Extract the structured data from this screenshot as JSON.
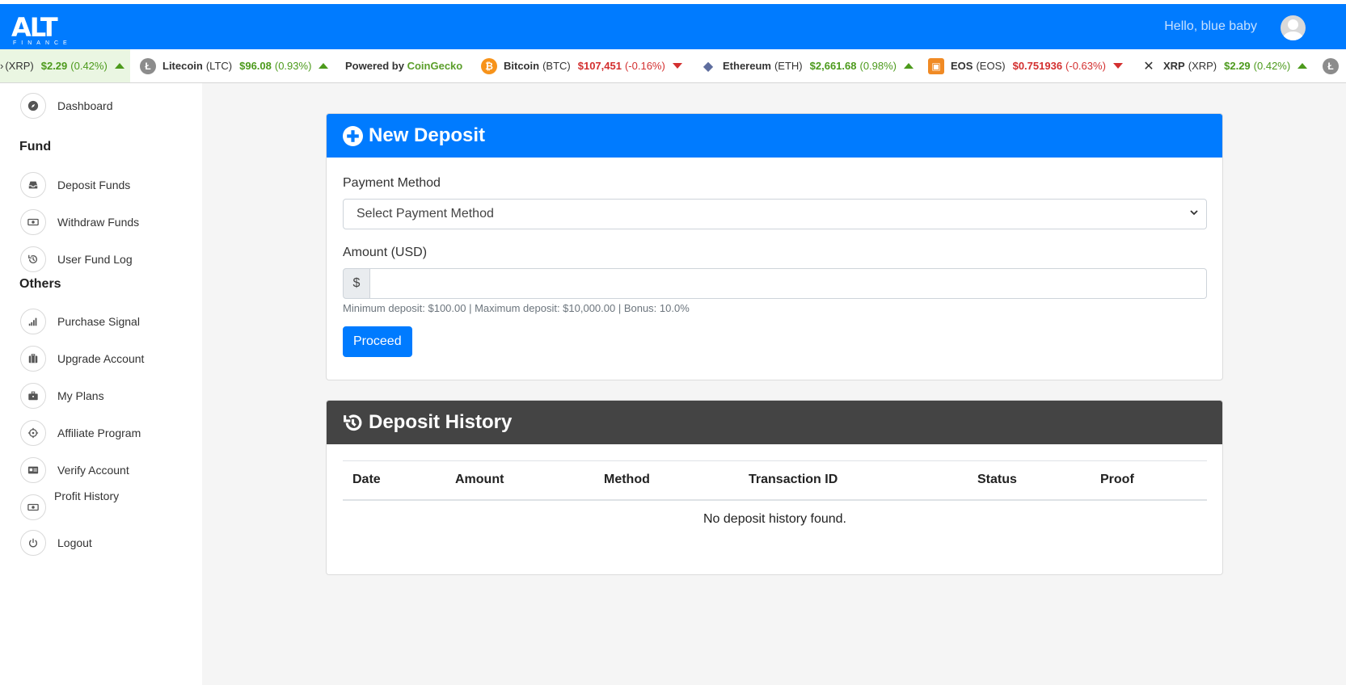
{
  "header": {
    "logo_text": "ALT",
    "logo_sub": "FINANCE",
    "greeting": "Hello, blue baby",
    "brand_color": "#007bff"
  },
  "ticker": {
    "items": [
      {
        "name": "",
        "symbol": "(XRP)",
        "price": "$2.29",
        "change": "(0.42%)",
        "direction": "up"
      },
      {
        "name": "Litecoin",
        "symbol": "(LTC)",
        "price": "$96.08",
        "change": "(0.93%)",
        "direction": "up"
      },
      {
        "name": "Bitcoin",
        "symbol": "(BTC)",
        "price": "$107,451",
        "change": "(-0.16%)",
        "direction": "down"
      },
      {
        "name": "Ethereum",
        "symbol": "(ETH)",
        "price": "$2,661.68",
        "change": "(0.98%)",
        "direction": "up"
      },
      {
        "name": "EOS",
        "symbol": "(EOS)",
        "price": "$0.751936",
        "change": "(-0.63%)",
        "direction": "down"
      },
      {
        "name": "XRP",
        "symbol": "(XRP)",
        "price": "$2.29",
        "change": "(0.42%)",
        "direction": "up"
      }
    ],
    "powered_prefix": "Powered by",
    "powered_brand": "CoinGecko"
  },
  "sidebar": {
    "dashboard": {
      "label": "Dashboard",
      "icon": "compass-icon"
    },
    "fund_heading": "Fund",
    "fund_items": [
      {
        "label": "Deposit Funds",
        "icon": "inbox-icon"
      },
      {
        "label": "Withdraw Funds",
        "icon": "money-icon"
      },
      {
        "label": "User Fund Log",
        "icon": "history-icon"
      }
    ],
    "others_heading": "Others",
    "others_items": [
      {
        "label": "Purchase Signal",
        "icon": "signal-icon"
      },
      {
        "label": "Upgrade Account",
        "icon": "suitcase-icon"
      },
      {
        "label": "My Plans",
        "icon": "briefcase-icon"
      },
      {
        "label": "Affiliate Program",
        "icon": "crosshair-icon"
      },
      {
        "label": "Verify Account",
        "icon": "id-card-icon"
      },
      {
        "label": "Profit History",
        "icon": "money-icon"
      },
      {
        "label": "Logout",
        "icon": "power-icon"
      }
    ]
  },
  "deposit": {
    "title": "New Deposit",
    "payment_label": "Payment Method",
    "payment_selected": "Select Payment Method",
    "amount_label": "Amount (USD)",
    "currency_symbol": "$",
    "amount_value": "",
    "help": "Minimum deposit: $100.00 | Maximum deposit: $10,000.00 | Bonus: 10.0%",
    "button": "Proceed"
  },
  "history": {
    "title": "Deposit History",
    "columns": [
      "Date",
      "Amount",
      "Method",
      "Transaction ID",
      "Status",
      "Proof"
    ],
    "empty": "No deposit history found."
  }
}
